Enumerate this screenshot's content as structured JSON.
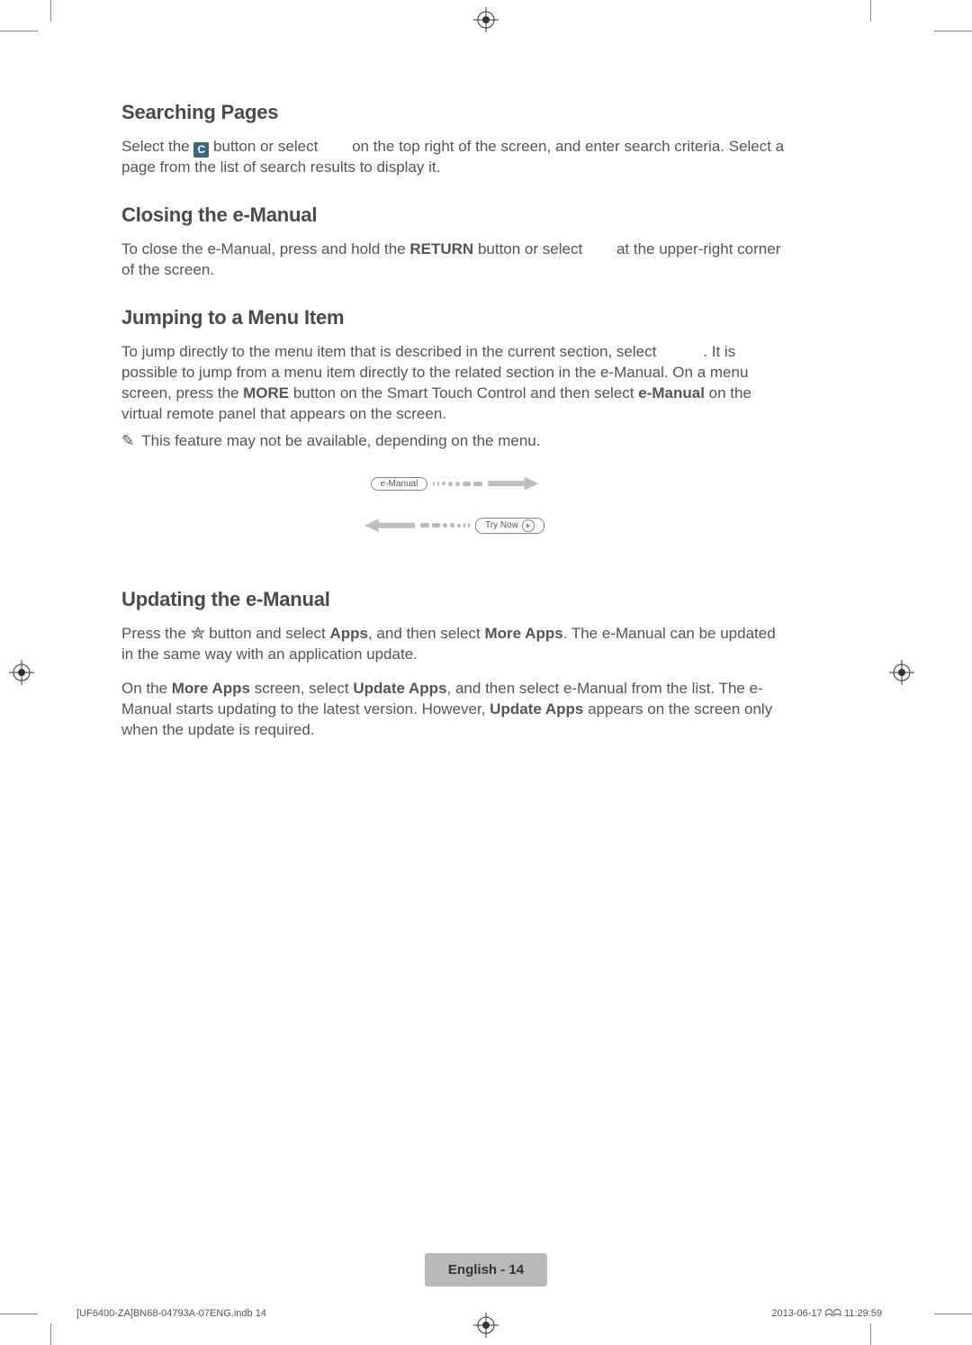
{
  "sections": {
    "searching": {
      "heading": "Searching Pages",
      "p1a": "Select the ",
      "c_label": "C",
      "p1b": " button or select ",
      "p1c": " on the top right of the screen, and enter search criteria. Select a page from the list of search results to display it."
    },
    "closing": {
      "heading": "Closing the e-Manual",
      "p1a": "To close the e-Manual, press and hold the ",
      "return_label": "RETURN",
      "p1b": " button or select ",
      "p1c": " at the upper-right corner of the screen."
    },
    "jumping": {
      "heading": "Jumping to a Menu Item",
      "p1a": "To jump directly to the menu item that is described in the current section, select ",
      "p1b": ". It is possible to jump from a menu item directly to the related section in the e-Manual. On a menu screen, press the ",
      "more_label": "MORE",
      "p1c": " button on the Smart Touch Control and then select ",
      "emanual_label": "e-Manual",
      "p1d": " on the virtual remote panel that appears on the screen.",
      "note": "This feature may not be available, depending on the menu."
    },
    "diagram": {
      "emanual_pill": "e-Manual",
      "trynow_pill": "Try Now"
    },
    "updating": {
      "heading": "Updating the e-Manual",
      "p1a": "Press the ",
      "p1b": " button and select ",
      "apps_label": "Apps",
      "p1c": ", and then select ",
      "moreapps_label": "More Apps",
      "p1d": ". The e-Manual can be updated in the same way with an application update.",
      "p2a": "On the ",
      "p2b": " screen, select ",
      "updateapps_label": "Update Apps",
      "p2c": ", and then select e-Manual from the list. The e-Manual starts updating to the latest version. However, ",
      "p2d": " appears on the screen only when the update is required."
    }
  },
  "footer": {
    "page_badge": "English - 14",
    "print_left": "[UF6400-ZA]BN68-04793A-07ENG.indb   14",
    "print_right": "2013-06-17   ᗣᗣ 11:29:59"
  }
}
